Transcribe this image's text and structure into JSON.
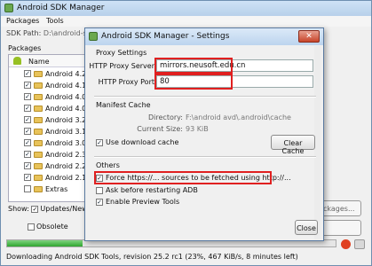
{
  "main_window": {
    "title": "Android SDK Manager",
    "menu": [
      "Packages",
      "Tools"
    ],
    "sdk_path_label": "SDK Path:",
    "sdk_path_value": "D:\\android-sdk",
    "packages_label": "Packages",
    "column_name": "Name",
    "packages": [
      {
        "label": "Android 4.2.2",
        "checked": true
      },
      {
        "label": "Android 4.1.2",
        "checked": true
      },
      {
        "label": "Android 4.0.3",
        "checked": true
      },
      {
        "label": "Android 4.0 (A",
        "checked": true
      },
      {
        "label": "Android 3.2 (A",
        "checked": true
      },
      {
        "label": "Android 3.1 (A",
        "checked": true
      },
      {
        "label": "Android 3.0 (A",
        "checked": true
      },
      {
        "label": "Android 2.3.3",
        "checked": true
      },
      {
        "label": "Android 2.2 (A",
        "checked": true
      },
      {
        "label": "Android 2.1 (A",
        "checked": true
      },
      {
        "label": "Extras",
        "checked": false
      }
    ],
    "show_label": "Show:",
    "updates_new_label": "Updates/New",
    "obsolete_label": "Obsolete",
    "packages_button_partial": "ckages...",
    "progress_fraction": 0.23,
    "status_text": "Downloading Android SDK Tools, revision 25.2 rc1 (23%, 467 KiB/s, 8 minutes left)"
  },
  "settings_dialog": {
    "title": "Android SDK Manager - Settings",
    "close_glyph": "✕",
    "proxy_settings_label": "Proxy Settings",
    "http_proxy_server_label": "HTTP Proxy Server",
    "http_proxy_server_value": "mirrors.neusoft.edu.cn",
    "http_proxy_port_label": "HTTP Proxy Port",
    "http_proxy_port_value": "80",
    "manifest_cache_label": "Manifest Cache",
    "directory_label": "Directory:",
    "directory_value": "F:\\android avd\\.android\\cache",
    "current_size_label": "Current Size:",
    "current_size_value": "93 KiB",
    "use_download_cache_label": "Use download cache",
    "clear_cache_button": "Clear Cache",
    "others_label": "Others",
    "force_https_label": "Force https://... sources to be fetched using http://...",
    "ask_before_restart_label": "Ask before restarting ADB",
    "enable_preview_tools_label": "Enable Preview Tools",
    "close_button": "Close"
  },
  "colors": {
    "highlight_red": "#e02020",
    "progress_green": "#2fa52f",
    "title_blue": "#bcd4ee"
  }
}
